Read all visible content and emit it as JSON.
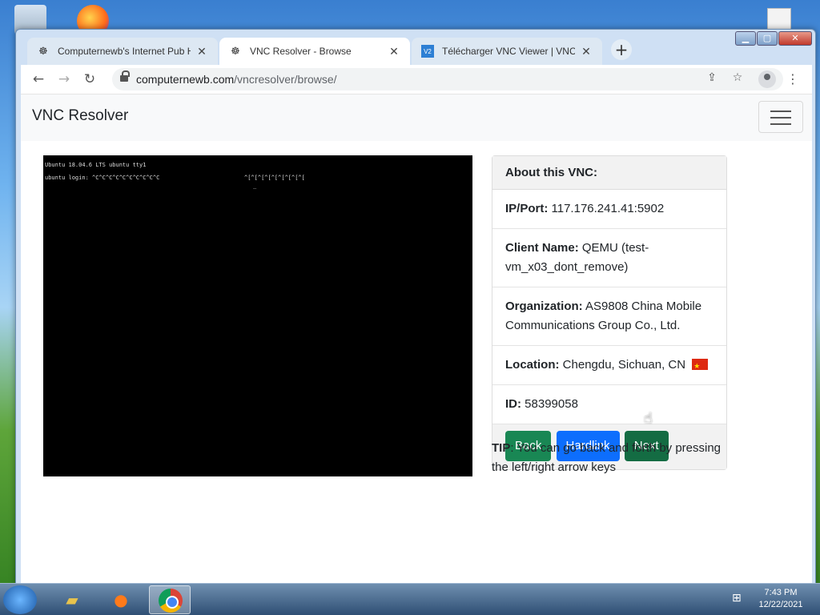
{
  "tabs": [
    {
      "label": "Computernewb's Internet Pub H",
      "icon": "computernewb-icon"
    },
    {
      "label": "VNC Resolver - Browse",
      "icon": "computernewb-icon"
    },
    {
      "label": "Télécharger VNC Viewer | VNC C",
      "icon": "vnc-icon"
    }
  ],
  "address_bar": {
    "domain": "computernewb.com",
    "path": "/vncresolver/browse/"
  },
  "page": {
    "brand": "VNC Resolver",
    "vnc_screen": {
      "line1": "Ubuntu 18.04.6 LTS ubuntu tty1",
      "line2": "ubuntu login: ^C^C^C^C^C^C^C^C^C^C",
      "line3": "^[^[^[^[^[^[^[^[^[",
      "line4": "_"
    },
    "card": {
      "header": "About this VNC:",
      "ip_label": "IP/Port:",
      "ip_value": "117.176.241.41:5902",
      "client_label": "Client Name:",
      "client_value": "QEMU (test-vm_x03_dont_remove)",
      "org_label": "Organization:",
      "org_value": "AS9808 China Mobile Communications Group Co., Ltd.",
      "location_label": "Location:",
      "location_value": "Chengdu, Sichuan, CN",
      "id_label": "ID:",
      "id_value": "58399058"
    },
    "buttons": {
      "back": "Back",
      "hardlink": "Hardlink",
      "next": "Next"
    },
    "tip_label": "TIP",
    "tip_text": ": You can go back and forth by pressing the left/right arrow keys"
  },
  "taskbar": {
    "time": "7:43 PM",
    "date": "12/22/2021"
  },
  "colors": {
    "back_button": "#198754",
    "hardlink_button": "#0d6efd",
    "next_button": "#146c43"
  }
}
